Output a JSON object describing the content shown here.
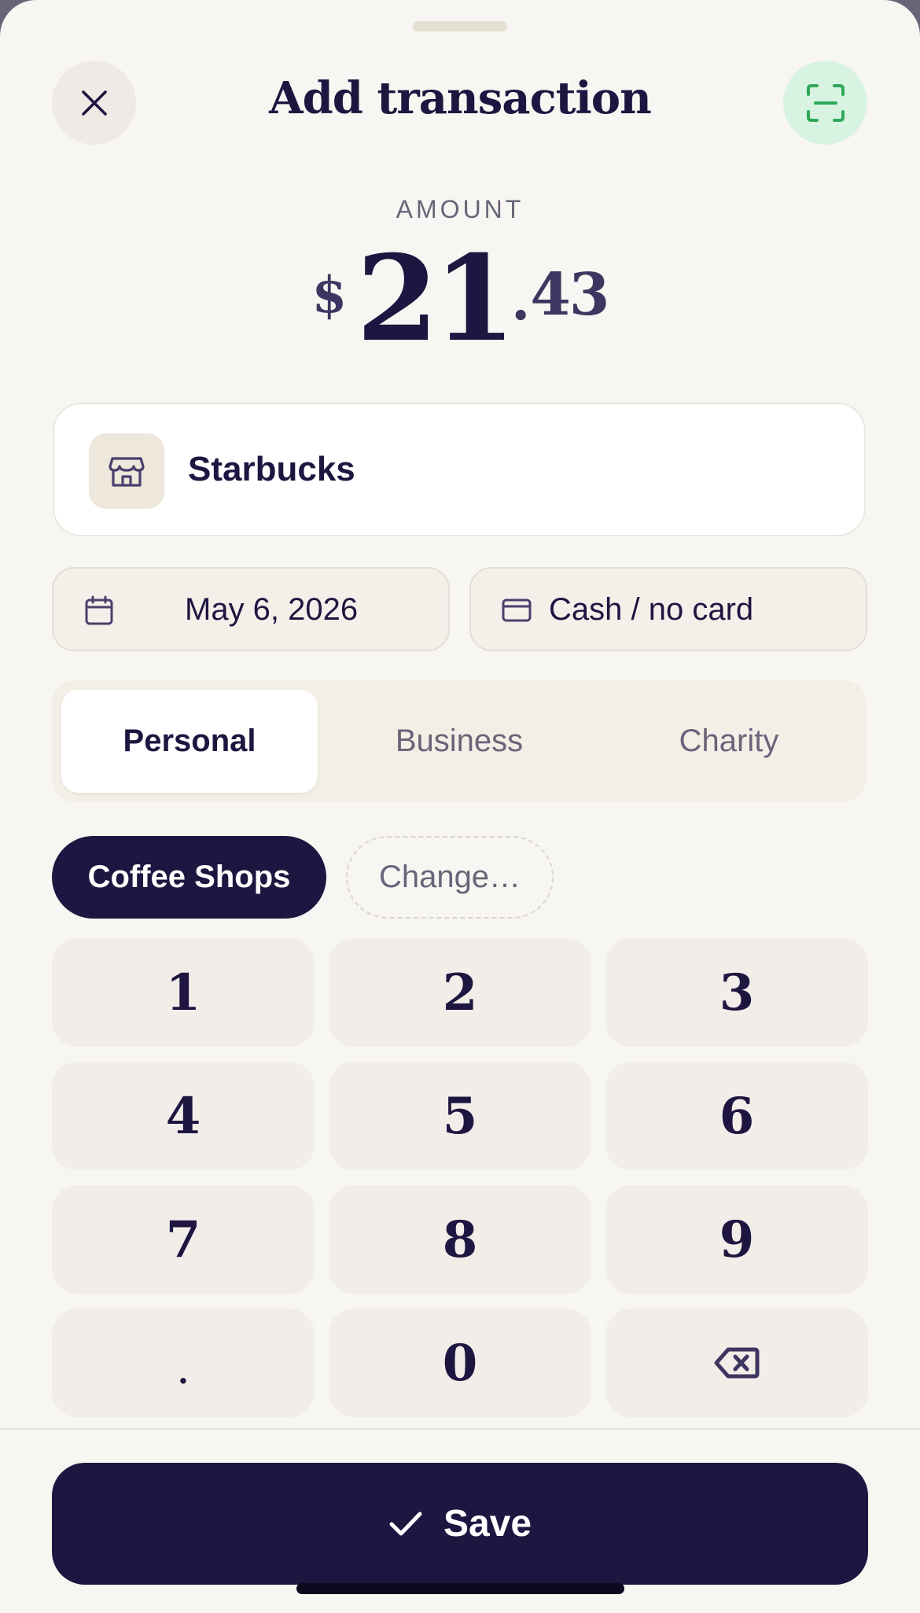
{
  "header": {
    "title": "Add transaction",
    "close_icon": "close-icon",
    "scan_icon": "scan-receipt-icon",
    "scan_accent": "#2fa85a"
  },
  "amount": {
    "label": "AMOUNT",
    "currency": "$",
    "whole": "21",
    "dot": ".",
    "cents": "43"
  },
  "merchant": {
    "icon": "storefront-icon",
    "name": "Starbucks"
  },
  "date": {
    "icon": "calendar-icon",
    "value": "May 6, 2026"
  },
  "payment": {
    "icon": "credit-card-icon",
    "value": "Cash / no card"
  },
  "type_tabs": [
    {
      "label": "Personal",
      "selected": true
    },
    {
      "label": "Business",
      "selected": false
    },
    {
      "label": "Charity",
      "selected": false
    }
  ],
  "category": {
    "selected": "Coffee Shops",
    "change_label": "Change…"
  },
  "keypad": [
    "1",
    "2",
    "3",
    "4",
    "5",
    "6",
    "7",
    "8",
    "9",
    ".",
    "0",
    "backspace"
  ],
  "save": {
    "icon": "check-icon",
    "label": "Save"
  },
  "colors": {
    "primary": "#1e1640",
    "background": "#f8f6f2",
    "muted": "#6a6479"
  }
}
